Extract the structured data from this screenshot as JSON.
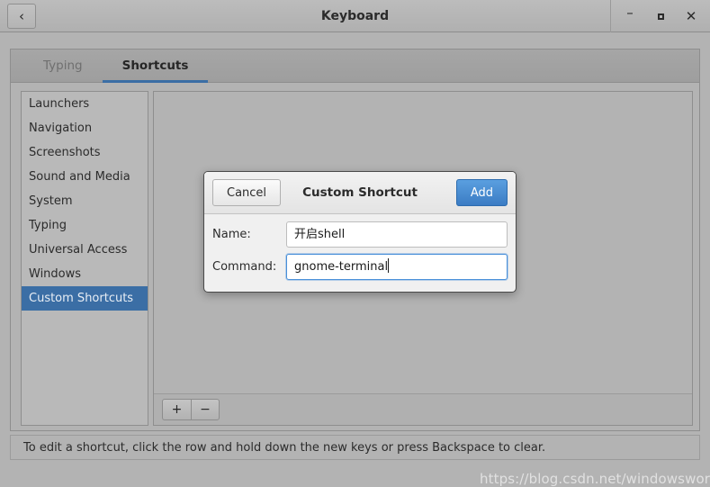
{
  "titlebar": {
    "title": "Keyboard",
    "back_icon": "chevron-left-icon",
    "minimize_icon": "minimize-icon",
    "maximize_icon": "maximize-icon",
    "close_icon": "close-icon",
    "close_glyph": "✕",
    "minimize_glyph": "–",
    "back_glyph": "‹"
  },
  "tabs": [
    {
      "label": "Typing",
      "active": false
    },
    {
      "label": "Shortcuts",
      "active": true
    }
  ],
  "sidebar": {
    "items": [
      {
        "label": "Launchers",
        "selected": false
      },
      {
        "label": "Navigation",
        "selected": false
      },
      {
        "label": "Screenshots",
        "selected": false
      },
      {
        "label": "Sound and Media",
        "selected": false
      },
      {
        "label": "System",
        "selected": false
      },
      {
        "label": "Typing",
        "selected": false
      },
      {
        "label": "Universal Access",
        "selected": false
      },
      {
        "label": "Windows",
        "selected": false
      },
      {
        "label": "Custom Shortcuts",
        "selected": true
      }
    ]
  },
  "panel": {
    "toolbar": {
      "add_label": "+",
      "remove_label": "−"
    }
  },
  "statusbar": {
    "text": "To edit a shortcut, click the row and hold down the new keys or press Backspace to clear."
  },
  "watermark": {
    "text": "https://blog.csdn.net/windowsworld"
  },
  "dialog": {
    "title": "Custom Shortcut",
    "cancel_label": "Cancel",
    "add_label": "Add",
    "fields": [
      {
        "label": "Name:",
        "value": "开启shell",
        "placeholder": "",
        "focused": false
      },
      {
        "label": "Command:",
        "value": "gnome-terminal",
        "placeholder": "",
        "focused": true
      }
    ]
  },
  "colors": {
    "accent_blue": "#3b6ea5",
    "button_blue": "#4a90d9",
    "window_bg": "#b3b3b3",
    "dialog_bg": "#f0f0f0"
  }
}
